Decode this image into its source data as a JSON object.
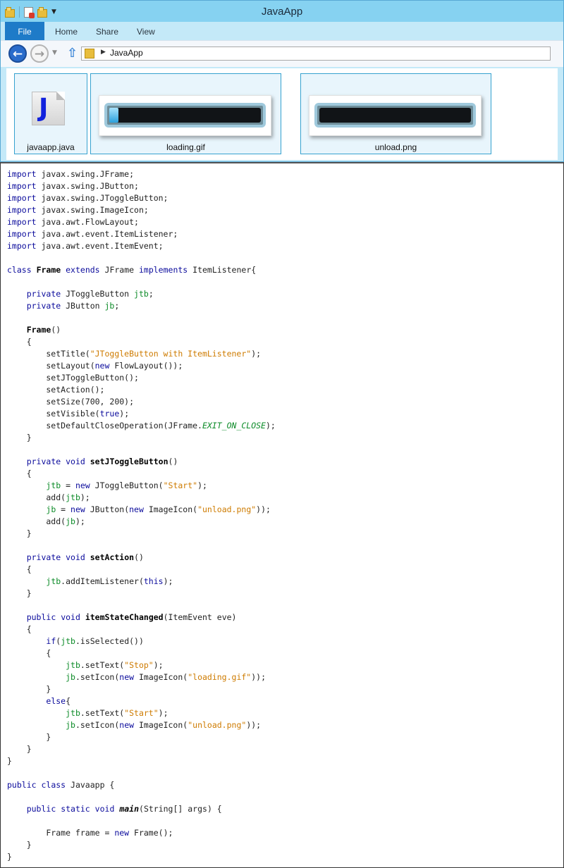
{
  "window": {
    "title": "JavaApp",
    "ribbon_tabs": [
      "File",
      "Home",
      "Share",
      "View"
    ],
    "breadcrumb": "JavaApp",
    "colors": {
      "titlebar": "#86d2f1",
      "file_tab": "#1e7bc8",
      "selection_border": "#36a2cf"
    }
  },
  "files": [
    {
      "name": "javaapp.java",
      "icon": "java-file-icon"
    },
    {
      "name": "loading.gif",
      "icon": "progress-bar-image",
      "progress": 0.06
    },
    {
      "name": "unload.png",
      "icon": "progress-bar-image",
      "progress": 0
    }
  ],
  "code": {
    "lines": [
      [
        {
          "t": "import",
          "c": "kw"
        },
        {
          "t": " javax.swing.JFrame;",
          "c": "pl"
        }
      ],
      [
        {
          "t": "import",
          "c": "kw"
        },
        {
          "t": " javax.swing.JButton;",
          "c": "pl"
        }
      ],
      [
        {
          "t": "import",
          "c": "kw"
        },
        {
          "t": " javax.swing.JToggleButton;",
          "c": "pl"
        }
      ],
      [
        {
          "t": "import",
          "c": "kw"
        },
        {
          "t": " javax.swing.ImageIcon;",
          "c": "pl"
        }
      ],
      [
        {
          "t": "import",
          "c": "kw"
        },
        {
          "t": " java.awt.FlowLayout;",
          "c": "pl"
        }
      ],
      [
        {
          "t": "import",
          "c": "kw"
        },
        {
          "t": " java.awt.event.ItemListener;",
          "c": "pl"
        }
      ],
      [
        {
          "t": "import",
          "c": "kw"
        },
        {
          "t": " java.awt.event.ItemEvent;",
          "c": "pl"
        }
      ],
      [],
      [
        {
          "t": "class",
          "c": "kw"
        },
        {
          "t": " ",
          "c": "pl"
        },
        {
          "t": "Frame",
          "c": "b"
        },
        {
          "t": " ",
          "c": "pl"
        },
        {
          "t": "extends",
          "c": "kw"
        },
        {
          "t": " JFrame ",
          "c": "pl"
        },
        {
          "t": "implements",
          "c": "kw"
        },
        {
          "t": " ItemListener{",
          "c": "pl"
        }
      ],
      [],
      [
        {
          "t": "    ",
          "c": "pl"
        },
        {
          "t": "private",
          "c": "kw"
        },
        {
          "t": " JToggleButton ",
          "c": "pl"
        },
        {
          "t": "jtb",
          "c": "fld"
        },
        {
          "t": ";",
          "c": "pl"
        }
      ],
      [
        {
          "t": "    ",
          "c": "pl"
        },
        {
          "t": "private",
          "c": "kw"
        },
        {
          "t": " JButton ",
          "c": "pl"
        },
        {
          "t": "jb",
          "c": "fld"
        },
        {
          "t": ";",
          "c": "pl"
        }
      ],
      [],
      [
        {
          "t": "    ",
          "c": "pl"
        },
        {
          "t": "Frame",
          "c": "b"
        },
        {
          "t": "()",
          "c": "pl"
        }
      ],
      [
        {
          "t": "    {",
          "c": "pl"
        }
      ],
      [
        {
          "t": "        setTitle(",
          "c": "pl"
        },
        {
          "t": "\"JToggleButton with ItemListener\"",
          "c": "str"
        },
        {
          "t": ");",
          "c": "pl"
        }
      ],
      [
        {
          "t": "        setLayout(",
          "c": "pl"
        },
        {
          "t": "new",
          "c": "kw"
        },
        {
          "t": " FlowLayout());",
          "c": "pl"
        }
      ],
      [
        {
          "t": "        setJToggleButton();",
          "c": "pl"
        }
      ],
      [
        {
          "t": "        setAction();",
          "c": "pl"
        }
      ],
      [
        {
          "t": "        setSize(700, 200);",
          "c": "pl"
        }
      ],
      [
        {
          "t": "        setVisible(",
          "c": "pl"
        },
        {
          "t": "true",
          "c": "kw"
        },
        {
          "t": ");",
          "c": "pl"
        }
      ],
      [
        {
          "t": "        setDefaultCloseOperation(JFrame.",
          "c": "pl"
        },
        {
          "t": "EXIT_ON_CLOSE",
          "c": "const"
        },
        {
          "t": ");",
          "c": "pl"
        }
      ],
      [
        {
          "t": "    }",
          "c": "pl"
        }
      ],
      [],
      [
        {
          "t": "    ",
          "c": "pl"
        },
        {
          "t": "private",
          "c": "kw"
        },
        {
          "t": " ",
          "c": "pl"
        },
        {
          "t": "void",
          "c": "kw"
        },
        {
          "t": " ",
          "c": "pl"
        },
        {
          "t": "setJToggleButton",
          "c": "b"
        },
        {
          "t": "()",
          "c": "pl"
        }
      ],
      [
        {
          "t": "    {",
          "c": "pl"
        }
      ],
      [
        {
          "t": "        ",
          "c": "pl"
        },
        {
          "t": "jtb",
          "c": "fld"
        },
        {
          "t": " = ",
          "c": "pl"
        },
        {
          "t": "new",
          "c": "kw"
        },
        {
          "t": " JToggleButton(",
          "c": "pl"
        },
        {
          "t": "\"Start\"",
          "c": "str"
        },
        {
          "t": ");",
          "c": "pl"
        }
      ],
      [
        {
          "t": "        add(",
          "c": "pl"
        },
        {
          "t": "jtb",
          "c": "fld"
        },
        {
          "t": ");",
          "c": "pl"
        }
      ],
      [
        {
          "t": "        ",
          "c": "pl"
        },
        {
          "t": "jb",
          "c": "fld"
        },
        {
          "t": " = ",
          "c": "pl"
        },
        {
          "t": "new",
          "c": "kw"
        },
        {
          "t": " JButton(",
          "c": "pl"
        },
        {
          "t": "new",
          "c": "kw"
        },
        {
          "t": " ImageIcon(",
          "c": "pl"
        },
        {
          "t": "\"unload.png\"",
          "c": "str"
        },
        {
          "t": "));",
          "c": "pl"
        }
      ],
      [
        {
          "t": "        add(",
          "c": "pl"
        },
        {
          "t": "jb",
          "c": "fld"
        },
        {
          "t": ");",
          "c": "pl"
        }
      ],
      [
        {
          "t": "    }",
          "c": "pl"
        }
      ],
      [],
      [
        {
          "t": "    ",
          "c": "pl"
        },
        {
          "t": "private",
          "c": "kw"
        },
        {
          "t": " ",
          "c": "pl"
        },
        {
          "t": "void",
          "c": "kw"
        },
        {
          "t": " ",
          "c": "pl"
        },
        {
          "t": "setAction",
          "c": "b"
        },
        {
          "t": "()",
          "c": "pl"
        }
      ],
      [
        {
          "t": "    {",
          "c": "pl"
        }
      ],
      [
        {
          "t": "        ",
          "c": "pl"
        },
        {
          "t": "jtb",
          "c": "fld"
        },
        {
          "t": ".addItemListener(",
          "c": "pl"
        },
        {
          "t": "this",
          "c": "kw"
        },
        {
          "t": ");",
          "c": "pl"
        }
      ],
      [
        {
          "t": "    }",
          "c": "pl"
        }
      ],
      [],
      [
        {
          "t": "    ",
          "c": "pl"
        },
        {
          "t": "public",
          "c": "kw"
        },
        {
          "t": " ",
          "c": "pl"
        },
        {
          "t": "void",
          "c": "kw"
        },
        {
          "t": " ",
          "c": "pl"
        },
        {
          "t": "itemStateChanged",
          "c": "b"
        },
        {
          "t": "(ItemEvent eve)",
          "c": "pl"
        }
      ],
      [
        {
          "t": "    {",
          "c": "pl"
        }
      ],
      [
        {
          "t": "        ",
          "c": "pl"
        },
        {
          "t": "if",
          "c": "kw"
        },
        {
          "t": "(",
          "c": "pl"
        },
        {
          "t": "jtb",
          "c": "fld"
        },
        {
          "t": ".isSelected())",
          "c": "pl"
        }
      ],
      [
        {
          "t": "        {",
          "c": "pl"
        }
      ],
      [
        {
          "t": "            ",
          "c": "pl"
        },
        {
          "t": "jtb",
          "c": "fld"
        },
        {
          "t": ".setText(",
          "c": "pl"
        },
        {
          "t": "\"Stop\"",
          "c": "str"
        },
        {
          "t": ");",
          "c": "pl"
        }
      ],
      [
        {
          "t": "            ",
          "c": "pl"
        },
        {
          "t": "jb",
          "c": "fld"
        },
        {
          "t": ".setIcon(",
          "c": "pl"
        },
        {
          "t": "new",
          "c": "kw"
        },
        {
          "t": " ImageIcon(",
          "c": "pl"
        },
        {
          "t": "\"loading.gif\"",
          "c": "str"
        },
        {
          "t": "));",
          "c": "pl"
        }
      ],
      [
        {
          "t": "        }",
          "c": "pl"
        }
      ],
      [
        {
          "t": "        ",
          "c": "pl"
        },
        {
          "t": "else",
          "c": "kw"
        },
        {
          "t": "{",
          "c": "pl"
        }
      ],
      [
        {
          "t": "            ",
          "c": "pl"
        },
        {
          "t": "jtb",
          "c": "fld"
        },
        {
          "t": ".setText(",
          "c": "pl"
        },
        {
          "t": "\"Start\"",
          "c": "str"
        },
        {
          "t": ");",
          "c": "pl"
        }
      ],
      [
        {
          "t": "            ",
          "c": "pl"
        },
        {
          "t": "jb",
          "c": "fld"
        },
        {
          "t": ".setIcon(",
          "c": "pl"
        },
        {
          "t": "new",
          "c": "kw"
        },
        {
          "t": " ImageIcon(",
          "c": "pl"
        },
        {
          "t": "\"unload.png\"",
          "c": "str"
        },
        {
          "t": "));",
          "c": "pl"
        }
      ],
      [
        {
          "t": "        }",
          "c": "pl"
        }
      ],
      [
        {
          "t": "    }",
          "c": "pl"
        }
      ],
      [
        {
          "t": "}",
          "c": "pl"
        }
      ],
      [],
      [
        {
          "t": "public",
          "c": "kw"
        },
        {
          "t": " ",
          "c": "pl"
        },
        {
          "t": "class",
          "c": "kw"
        },
        {
          "t": " Javaapp {",
          "c": "pl"
        }
      ],
      [],
      [
        {
          "t": "    ",
          "c": "pl"
        },
        {
          "t": "public",
          "c": "kw"
        },
        {
          "t": " ",
          "c": "pl"
        },
        {
          "t": "static",
          "c": "kw"
        },
        {
          "t": " ",
          "c": "pl"
        },
        {
          "t": "void",
          "c": "kw"
        },
        {
          "t": " ",
          "c": "pl"
        },
        {
          "t": "main",
          "c": "bi"
        },
        {
          "t": "(String[] args) {",
          "c": "pl"
        }
      ],
      [],
      [
        {
          "t": "        Frame frame = ",
          "c": "pl"
        },
        {
          "t": "new",
          "c": "kw"
        },
        {
          "t": " Frame();",
          "c": "pl"
        }
      ],
      [
        {
          "t": "    }",
          "c": "pl"
        }
      ],
      [
        {
          "t": "}",
          "c": "pl"
        }
      ]
    ]
  }
}
